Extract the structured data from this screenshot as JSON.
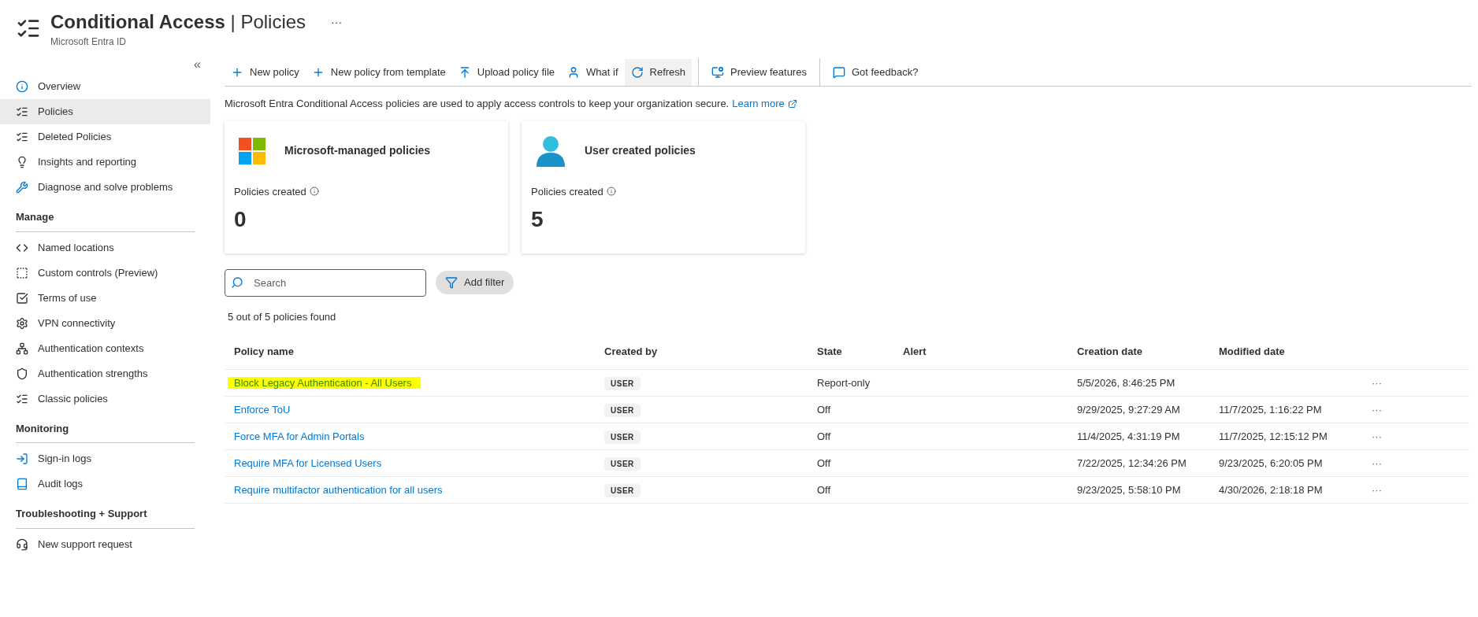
{
  "header": {
    "title": "Conditional Access",
    "separator": "|",
    "subtitle_page": "Policies",
    "more": "···",
    "breadcrumb": "Microsoft Entra ID"
  },
  "sidebar": {
    "collapse": "«",
    "sections": [
      {
        "items": [
          {
            "label": "Overview",
            "kind": "info",
            "selected": false
          },
          {
            "label": "Policies",
            "kind": "list",
            "selected": true
          },
          {
            "label": "Deleted Policies",
            "kind": "list",
            "selected": false
          },
          {
            "label": "Insights and reporting",
            "kind": "bulb",
            "selected": false
          },
          {
            "label": "Diagnose and solve problems",
            "kind": "tools",
            "selected": false
          }
        ]
      },
      {
        "heading": "Manage",
        "items": [
          {
            "label": "Named locations",
            "kind": "location",
            "selected": false
          },
          {
            "label": "Custom controls (Preview)",
            "kind": "custom",
            "selected": false
          },
          {
            "label": "Terms of use",
            "kind": "terms",
            "selected": false
          },
          {
            "label": "VPN connectivity",
            "kind": "gear",
            "selected": false
          },
          {
            "label": "Authentication contexts",
            "kind": "network",
            "selected": false
          },
          {
            "label": "Authentication strengths",
            "kind": "shield",
            "selected": false
          },
          {
            "label": "Classic policies",
            "kind": "list",
            "selected": false
          }
        ]
      },
      {
        "heading": "Monitoring",
        "items": [
          {
            "label": "Sign-in logs",
            "kind": "signin",
            "selected": false
          },
          {
            "label": "Audit logs",
            "kind": "book",
            "selected": false
          }
        ]
      },
      {
        "heading": "Troubleshooting + Support",
        "items": [
          {
            "label": "New support request",
            "kind": "support",
            "selected": false
          }
        ]
      }
    ]
  },
  "toolbar": [
    [
      {
        "label": "New policy",
        "kind": "add",
        "selected": false
      },
      {
        "label": "New policy from template",
        "kind": "add",
        "selected": false
      },
      {
        "label": "Upload policy file",
        "kind": "upload",
        "selected": false
      },
      {
        "label": "What if",
        "kind": "person",
        "selected": false
      },
      {
        "label": "Refresh",
        "kind": "refresh",
        "selected": true
      }
    ],
    [
      {
        "label": "Preview features",
        "kind": "preview",
        "selected": false
      }
    ],
    [
      {
        "label": "Got feedback?",
        "kind": "feedback",
        "selected": false
      }
    ]
  ],
  "intro": {
    "text": "Microsoft Entra Conditional Access policies are used to apply access controls to keep your organization secure.",
    "link": "Learn more"
  },
  "cards": [
    {
      "title": "Microsoft-managed policies",
      "kind": "microsoft",
      "label": "Policies created",
      "value": "0"
    },
    {
      "title": "User created policies",
      "kind": "user",
      "label": "Policies created",
      "value": "5"
    }
  ],
  "search": {
    "placeholder": "Search"
  },
  "filter_button": "Add filter",
  "result_count": "5 out of 5 policies found",
  "table": {
    "columns": [
      "Policy name",
      "Created by",
      "State",
      "Alert",
      "Creation date",
      "Modified date"
    ],
    "rows": [
      {
        "name": "Block Legacy Authentication - All Users",
        "highlighted": true,
        "created_by": "USER",
        "state": "Report-only",
        "creation_date": "5/5/2026, 8:46:25 PM",
        "more": "···"
      },
      {
        "name": "Enforce ToU",
        "highlighted": false,
        "created_by": "USER",
        "state": "Off",
        "creation_date": "9/29/2025, 9:27:29 AM",
        "modified_date": "11/7/2025, 1:16:22 PM",
        "more": "···"
      },
      {
        "name": "Force MFA for Admin Portals",
        "highlighted": false,
        "created_by": "USER",
        "state": "Off",
        "creation_date": "11/4/2025, 4:31:19 PM",
        "modified_date": "11/7/2025, 12:15:12 PM",
        "more": "···"
      },
      {
        "name": "Require MFA for Licensed Users",
        "highlighted": false,
        "created_by": "USER",
        "state": "Off",
        "creation_date": "7/22/2025, 12:34:26 PM",
        "modified_date": "9/23/2025, 6:20:05 PM",
        "more": "···"
      },
      {
        "name": "Require multifactor authentication for all users",
        "highlighted": false,
        "created_by": "USER",
        "state": "Off",
        "creation_date": "9/23/2025, 5:58:10 PM",
        "modified_date": "4/30/2026, 2:18:18 PM",
        "more": "···"
      }
    ]
  }
}
